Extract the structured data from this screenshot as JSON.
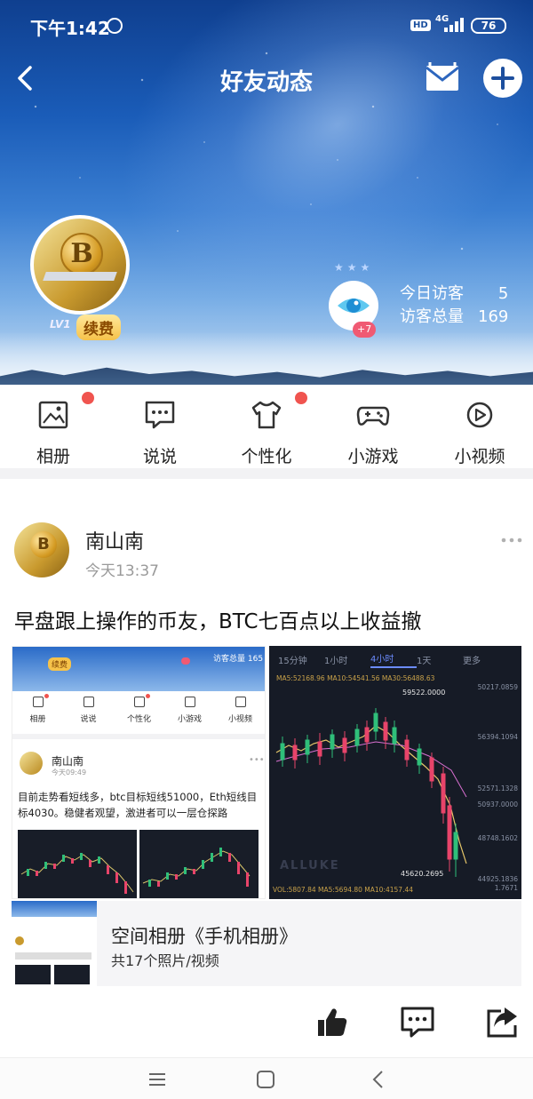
{
  "status_bar": {
    "time": "下午1:42",
    "hd": "HD",
    "network": "4G",
    "battery": "76"
  },
  "header": {
    "title": "好友动态"
  },
  "profile": {
    "level": "LV1",
    "renew_label": "续费",
    "visitor_badge": "+7",
    "today_visitors_label": "今日访客",
    "today_visitors_value": "5",
    "total_visitors_label": "访客总量",
    "total_visitors_value": "169"
  },
  "functions": [
    {
      "label": "相册",
      "icon": "photo-album-icon",
      "dot": true
    },
    {
      "label": "说说",
      "icon": "chat-bubble-icon",
      "dot": false
    },
    {
      "label": "个性化",
      "icon": "tshirt-icon",
      "dot": true
    },
    {
      "label": "小游戏",
      "icon": "gamepad-icon",
      "dot": false
    },
    {
      "label": "小视频",
      "icon": "play-video-icon",
      "dot": false
    }
  ],
  "post": {
    "author": "南山南",
    "time": "今天13:37",
    "text": "早盘跟上操作的币友，BTC七百点以上收益撤",
    "screenshot1": {
      "renew": "续费",
      "visitors": "访客总量 165",
      "functions": [
        "相册",
        "说说",
        "个性化",
        "小游戏",
        "小视频"
      ],
      "author": "南山南",
      "time": "今天09:49",
      "text": "目前走势看短线多，btc目标短线51000，Eth短线目标4030。稳健者观望，激进者可以一层仓探路"
    },
    "screenshot2": {
      "tabs": [
        "15分钟",
        "1小时",
        "4小时",
        "1天",
        "更多"
      ],
      "active_tab": "4小时",
      "ma_line": "MA5:52168.96   MA10:54541.56   MA30:56488.63",
      "high_label": "59522.0000",
      "low_label": "45620.2695",
      "axis": [
        "50217.0859",
        "56394.1094",
        "52571.1328",
        "50937.0000",
        "48748.1602",
        "44925.1836",
        "1.7671"
      ],
      "footer": "VOL:5807.84  MA5:5694.80  MA10:4157.44",
      "watermark": "ALLUKE"
    },
    "album_title": "空间相册《手机相册》",
    "album_count": "共17个照片/视频"
  },
  "colors": {
    "accent_red": "#f0544f",
    "badge_pink": "#f05a73",
    "renew_gold": "#f6c24a"
  }
}
